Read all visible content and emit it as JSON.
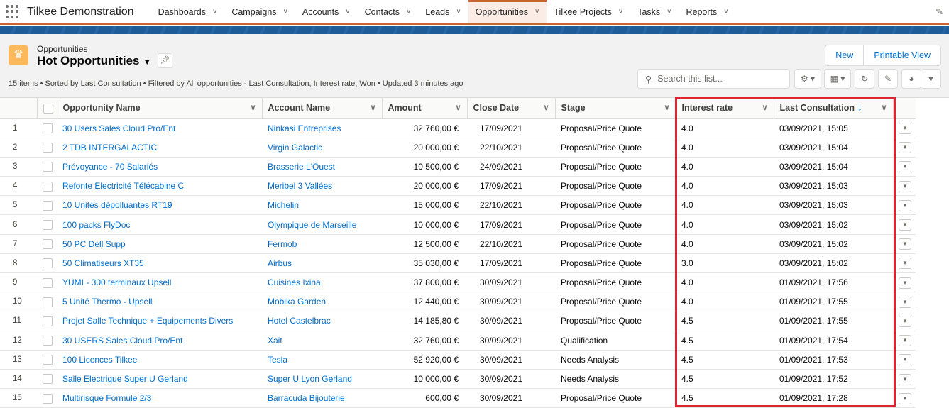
{
  "nav": {
    "app_name": "Tilkee Demonstration",
    "tabs": [
      "Dashboards",
      "Campaigns",
      "Accounts",
      "Contacts",
      "Leads",
      "Opportunities",
      "Tilkee Projects",
      "Tasks",
      "Reports"
    ],
    "active_tab": "Opportunities"
  },
  "header": {
    "object_label": "Opportunities",
    "list_title": "Hot Opportunities",
    "meta": "15 items • Sorted by Last Consultation • Filtered by All opportunities - Last Consultation, Interest rate, Won • Updated 3 minutes ago",
    "new_label": "New",
    "printable_label": "Printable View",
    "search_placeholder": "Search this list..."
  },
  "table": {
    "columns": [
      "Opportunity Name",
      "Account Name",
      "Amount",
      "Close Date",
      "Stage",
      "Interest rate",
      "Last Consultation"
    ],
    "sort_indicator": "↓",
    "rows": [
      [
        "30 Users Sales Cloud Pro/Ent",
        "Ninkasi Entreprises",
        "32 760,00 €",
        "17/09/2021",
        "Proposal/Price Quote",
        "4.0",
        "03/09/2021, 15:05"
      ],
      [
        "2 TDB INTERGALACTIC",
        "Virgin Galactic",
        "20 000,00 €",
        "22/10/2021",
        "Proposal/Price Quote",
        "4.0",
        "03/09/2021, 15:04"
      ],
      [
        "Prévoyance - 70 Salariés",
        "Brasserie L'Ouest",
        "10 500,00 €",
        "24/09/2021",
        "Proposal/Price Quote",
        "4.0",
        "03/09/2021, 15:04"
      ],
      [
        "Refonte Electricité Télécabine C",
        "Meribel 3 Vallées",
        "20 000,00 €",
        "17/09/2021",
        "Proposal/Price Quote",
        "4.0",
        "03/09/2021, 15:03"
      ],
      [
        "10 Unités dépolluantes RT19",
        "Michelin",
        "15 000,00 €",
        "22/10/2021",
        "Proposal/Price Quote",
        "4.0",
        "03/09/2021, 15:03"
      ],
      [
        "100 packs FlyDoc",
        "Olympique de Marseille",
        "10 000,00 €",
        "17/09/2021",
        "Proposal/Price Quote",
        "4.0",
        "03/09/2021, 15:02"
      ],
      [
        "50 PC Dell Supp",
        "Fermob",
        "12 500,00 €",
        "22/10/2021",
        "Proposal/Price Quote",
        "4.0",
        "03/09/2021, 15:02"
      ],
      [
        "50 Climatiseurs XT35",
        "Airbus",
        "35 030,00 €",
        "17/09/2021",
        "Proposal/Price Quote",
        "3.0",
        "03/09/2021, 15:02"
      ],
      [
        "YUMI - 300 terminaux Upsell",
        "Cuisines Ixina",
        "37 800,00 €",
        "30/09/2021",
        "Proposal/Price Quote",
        "4.0",
        "01/09/2021, 17:56"
      ],
      [
        "5 Unité Thermo - Upsell",
        "Mobika Garden",
        "12 440,00 €",
        "30/09/2021",
        "Proposal/Price Quote",
        "4.0",
        "01/09/2021, 17:55"
      ],
      [
        "Projet Salle Technique + Equipements Divers",
        "Hotel Castelbrac",
        "14 185,80 €",
        "30/09/2021",
        "Proposal/Price Quote",
        "4.5",
        "01/09/2021, 17:55"
      ],
      [
        "30 USERS Sales Cloud Pro/Ent",
        "Xait",
        "32 760,00 €",
        "30/09/2021",
        "Qualification",
        "4.5",
        "01/09/2021, 17:54"
      ],
      [
        "100 Licences Tilkee",
        "Tesla",
        "52 920,00 €",
        "30/09/2021",
        "Needs Analysis",
        "4.5",
        "01/09/2021, 17:53"
      ],
      [
        "Salle Electrique Super U Gerland",
        "Super U Lyon Gerland",
        "10 000,00 €",
        "30/09/2021",
        "Needs Analysis",
        "4.5",
        "01/09/2021, 17:52"
      ],
      [
        "Multirisque Formule 2/3",
        "Barracuda Bijouterie",
        "600,00 €",
        "30/09/2021",
        "Proposal/Price Quote",
        "4.5",
        "01/09/2021, 17:28"
      ]
    ]
  }
}
